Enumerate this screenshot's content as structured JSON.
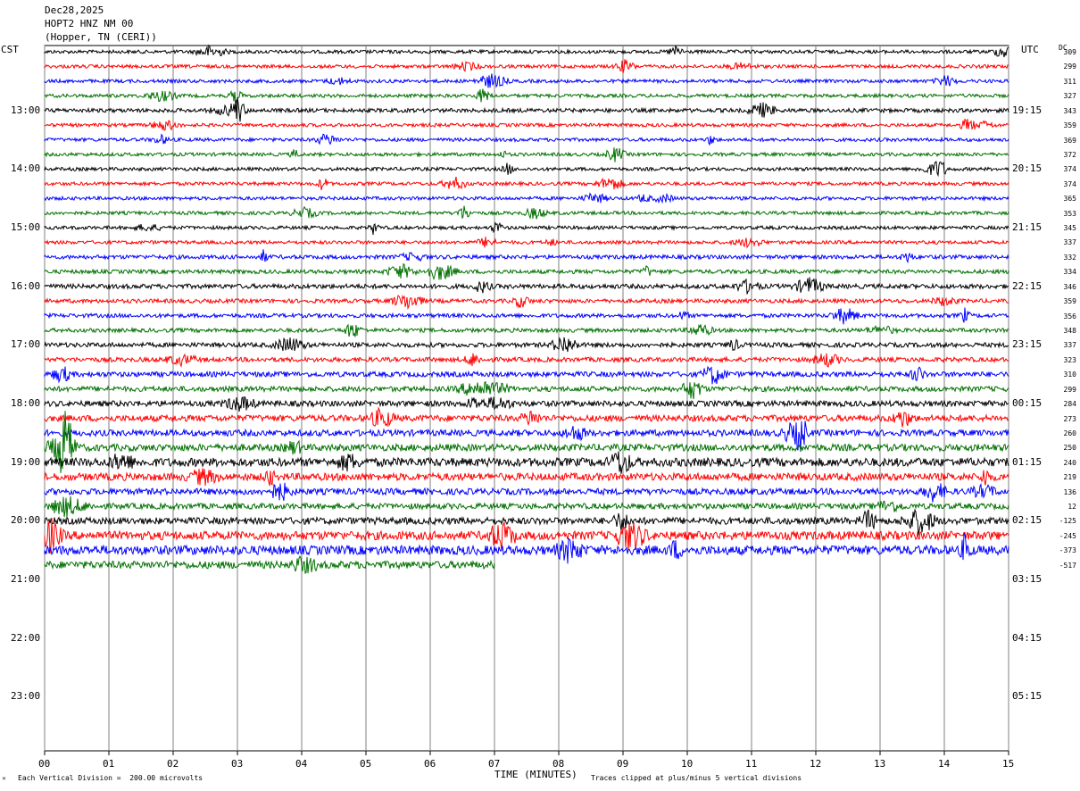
{
  "header": {
    "date": "Dec28,2025",
    "station": "HOPT2 HNZ NM 00",
    "location": "(Hopper, TN (CERI))"
  },
  "left_tz": "CST",
  "right_tz": "UTC",
  "dc_label": "DC",
  "footer": {
    "scale_note": "Each Vertical Division =  200.00 microvolts",
    "clip_note": "Traces clipped at plus/minus 5 vertical divisions",
    "corner_mark": "ᴹ"
  },
  "chart_data": {
    "type": "line",
    "xlabel": "TIME (MINUTES)",
    "x_ticks": [
      "00",
      "01",
      "02",
      "03",
      "04",
      "05",
      "06",
      "07",
      "08",
      "09",
      "10",
      "11",
      "12",
      "13",
      "14",
      "15"
    ],
    "xlim": [
      0,
      15
    ],
    "cst_hours": [
      "13:00",
      "14:00",
      "15:00",
      "16:00",
      "17:00",
      "18:00",
      "19:00",
      "20:00",
      "21:00",
      "22:00",
      "23:00"
    ],
    "utc_hours": [
      "19:15",
      "20:15",
      "21:15",
      "22:15",
      "23:15",
      "00:15",
      "01:15",
      "02:15",
      "03:15",
      "04:15",
      "05:15"
    ],
    "trace_colors": [
      "#000000",
      "#ff0000",
      "#0000ff",
      "#007000"
    ],
    "dc_offsets": [
      "309",
      "299",
      "311",
      "327",
      "343",
      "359",
      "369",
      "372",
      "374",
      "374",
      "365",
      "353",
      "345",
      "337",
      "332",
      "334",
      "346",
      "359",
      "356",
      "348",
      "337",
      "323",
      "310",
      "299",
      "284",
      "273",
      "260",
      "250",
      "240",
      "219",
      "136",
      "12",
      "-125",
      "-245",
      "-373",
      "-517"
    ],
    "trace_count": 36,
    "last_trace_end_minute": 7.0,
    "noise_levels": [
      0.6,
      0.6,
      0.6,
      0.6,
      0.7,
      0.6,
      0.6,
      0.6,
      0.6,
      0.6,
      0.6,
      0.6,
      0.6,
      0.6,
      0.7,
      0.7,
      0.8,
      0.7,
      0.7,
      0.7,
      0.8,
      0.8,
      0.9,
      0.9,
      1.0,
      1.1,
      1.1,
      1.2,
      1.5,
      1.3,
      1.1,
      1.0,
      1.2,
      1.5,
      1.6,
      1.3
    ]
  }
}
